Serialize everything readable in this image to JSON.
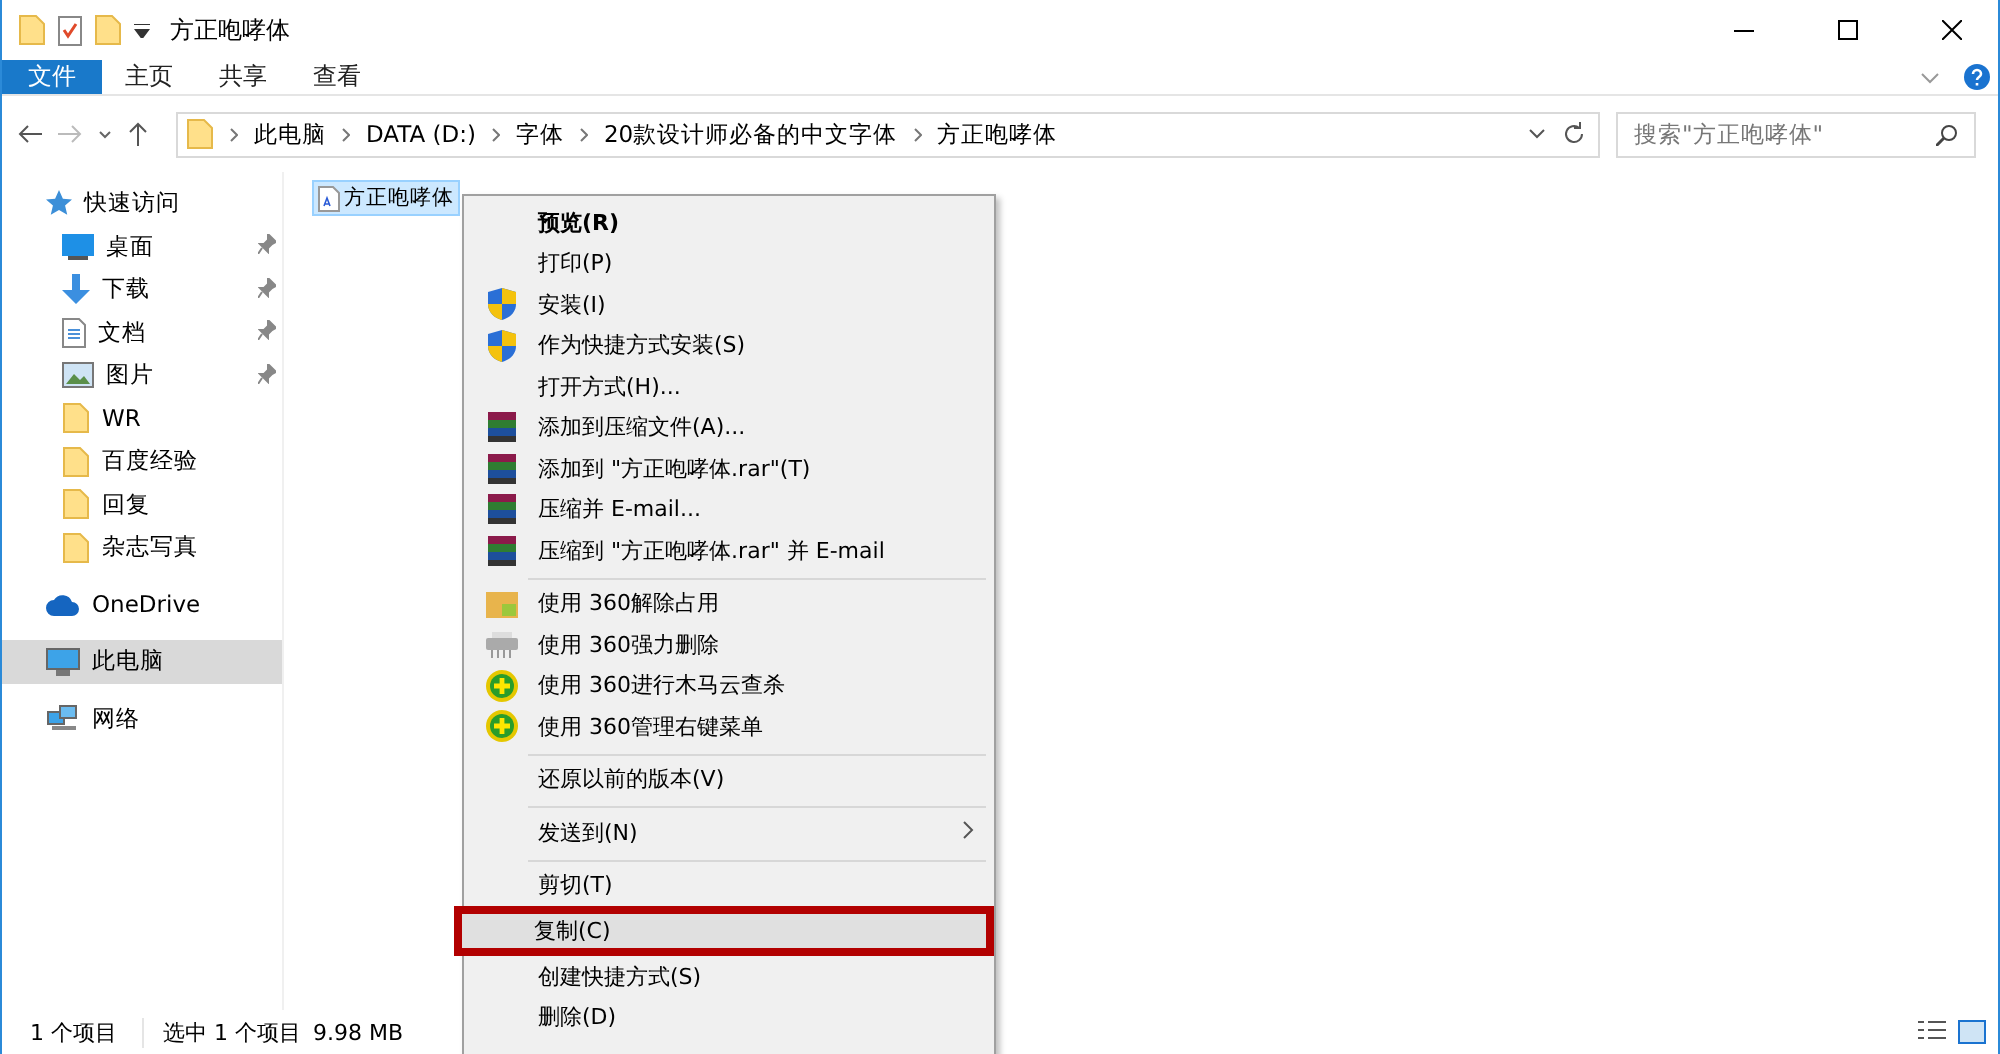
{
  "window": {
    "title": "方正咆哮体"
  },
  "ribbon_tabs": [
    {
      "label": "文件",
      "selected": true
    },
    {
      "label": "主页",
      "selected": false
    },
    {
      "label": "共享",
      "selected": false
    },
    {
      "label": "查看",
      "selected": false
    }
  ],
  "address_bar": {
    "crumbs": [
      "此电脑",
      "DATA (D:)",
      "字体",
      "20款设计师必备的中文字体",
      "方正咆哮体"
    ]
  },
  "search": {
    "placeholder": "搜索\"方正咆哮体\""
  },
  "sidebar": {
    "items": [
      {
        "label": "快速访问",
        "kind": "star",
        "pinned": false,
        "selected": false,
        "children": [
          {
            "label": "桌面",
            "kind": "desktop",
            "pinned": true,
            "selected": false
          },
          {
            "label": "下载",
            "kind": "download",
            "pinned": true,
            "selected": false
          },
          {
            "label": "文档",
            "kind": "document",
            "pinned": true,
            "selected": false
          },
          {
            "label": "图片",
            "kind": "picture",
            "pinned": true,
            "selected": false
          },
          {
            "label": "WR",
            "kind": "folder",
            "pinned": false,
            "selected": false
          },
          {
            "label": "百度经验",
            "kind": "folder",
            "pinned": false,
            "selected": false
          },
          {
            "label": "回复",
            "kind": "folder",
            "pinned": false,
            "selected": false
          },
          {
            "label": "杂志写真",
            "kind": "folder",
            "pinned": false,
            "selected": false
          }
        ]
      },
      {
        "label": "OneDrive",
        "kind": "cloud",
        "pinned": false,
        "selected": false
      },
      {
        "label": "此电脑",
        "kind": "computer",
        "pinned": false,
        "selected": true
      },
      {
        "label": "网络",
        "kind": "network",
        "pinned": false,
        "selected": false
      }
    ]
  },
  "files": [
    {
      "name": "方正咆哮体",
      "selected": true
    }
  ],
  "context_menu": [
    {
      "kind": "plain",
      "label": "预览(R)",
      "bold": true,
      "submenu": false,
      "selected": false
    },
    {
      "kind": "plain",
      "label": "打印(P)",
      "bold": false,
      "submenu": false,
      "selected": false
    },
    {
      "kind": "shield",
      "label": "安装(I)",
      "bold": false,
      "submenu": false,
      "selected": false
    },
    {
      "kind": "shield",
      "label": "作为快捷方式安装(S)",
      "bold": false,
      "submenu": false,
      "selected": false
    },
    {
      "kind": "plain",
      "label": "打开方式(H)...",
      "bold": false,
      "submenu": false,
      "selected": false
    },
    {
      "kind": "archive",
      "label": "添加到压缩文件(A)...",
      "bold": false,
      "submenu": false,
      "selected": false
    },
    {
      "kind": "archive",
      "label": "添加到 \"方正咆哮体.rar\"(T)",
      "bold": false,
      "submenu": false,
      "selected": false
    },
    {
      "kind": "archive",
      "label": "压缩并 E-mail...",
      "bold": false,
      "submenu": false,
      "selected": false
    },
    {
      "kind": "archive",
      "label": "压缩到 \"方正咆哮体.rar\" 并 E-mail",
      "bold": false,
      "submenu": false,
      "selected": false
    },
    {
      "kind": "separator"
    },
    {
      "kind": "unlock",
      "label": "使用 360解除占用",
      "bold": false,
      "submenu": false,
      "selected": false
    },
    {
      "kind": "shred",
      "label": "使用 360强力删除",
      "bold": false,
      "submenu": false,
      "selected": false
    },
    {
      "kind": "guard",
      "label": "使用 360进行木马云查杀",
      "bold": false,
      "submenu": false,
      "selected": false
    },
    {
      "kind": "guard",
      "label": "使用 360管理右键菜单",
      "bold": false,
      "submenu": false,
      "selected": false
    },
    {
      "kind": "separator"
    },
    {
      "kind": "plain",
      "label": "还原以前的版本(V)",
      "bold": false,
      "submenu": false,
      "selected": false
    },
    {
      "kind": "separator"
    },
    {
      "kind": "plain",
      "label": "发送到(N)",
      "bold": false,
      "submenu": true,
      "selected": false
    },
    {
      "kind": "separator"
    },
    {
      "kind": "plain",
      "label": "剪切(T)",
      "bold": false,
      "submenu": false,
      "selected": false
    },
    {
      "kind": "plain",
      "label": "复制(C)",
      "bold": false,
      "submenu": false,
      "selected": true
    },
    {
      "kind": "plain",
      "label": "创建快捷方式(S)",
      "bold": false,
      "submenu": false,
      "selected": false
    },
    {
      "kind": "plain",
      "label": "删除(D)",
      "bold": false,
      "submenu": false,
      "selected": false
    }
  ],
  "status_bar": {
    "count": "1 个项目",
    "selection": "选中 1 个项目",
    "size": "9.98 MB"
  }
}
